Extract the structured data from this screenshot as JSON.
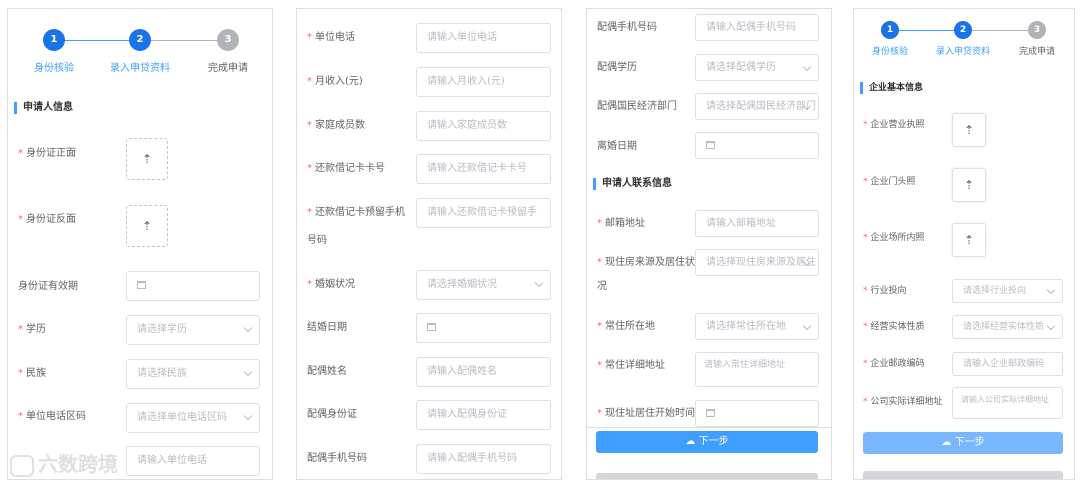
{
  "colors": {
    "primary": "#409eff",
    "step_active": "#1a73e8",
    "required": "#f56c6c"
  },
  "steps": [
    {
      "num": "1",
      "label": "身份核验"
    },
    {
      "num": "2",
      "label": "录入申贷资料"
    },
    {
      "num": "3",
      "label": "完成申请"
    }
  ],
  "panel1": {
    "section_title": "申请人信息",
    "id_front": "身份证正面",
    "id_back": "身份证反面",
    "id_validity": "身份证有效期",
    "education": "学历",
    "education_ph": "请选择学历",
    "ethnicity": "民族",
    "ethnicity_ph": "请选择民族",
    "area_code": "单位电话区码",
    "area_code_ph": "请选择单位电话区码",
    "unit_phone_ph": "请输入单位电话"
  },
  "panel2": {
    "unit_phone": "单位电话",
    "unit_phone_ph": "请输入单位电话",
    "income": "月收入(元)",
    "income_ph": "请输入月收入(元)",
    "family": "家庭成员数",
    "family_ph": "请输入家庭成员数",
    "card": "还款借记卡卡号",
    "card_ph": "请输入还款借记卡卡号",
    "card_phone_1": "还款借记卡预留手机",
    "card_phone_2": "号码",
    "card_phone_ph": "请输入还款借记卡预留手",
    "marital": "婚姻状况",
    "marital_ph": "请选择婚姻状况",
    "marriage_date": "结婚日期",
    "spouse_name": "配偶姓名",
    "spouse_name_ph": "请输入配偶姓名",
    "spouse_id": "配偶身份证",
    "spouse_id_ph": "请输入配偶身份证",
    "spouse_phone": "配偶手机号码",
    "spouse_phone_ph": "请输入配偶手机号码"
  },
  "panel3": {
    "spouse_phone": "配偶手机号码",
    "spouse_phone_ph": "请输入配偶手机号码",
    "spouse_edu": "配偶学历",
    "spouse_edu_ph": "请选择配偶学历",
    "spouse_dept": "配偶国民经济部门",
    "spouse_dept_ph": "请选择配偶国民经济部门",
    "divorce_date": "离婚日期",
    "section_title": "申请人联系信息",
    "email": "邮箱地址",
    "email_ph": "请输入邮箱地址",
    "housing_1": "现住房来源及居住状",
    "housing_2": "况",
    "housing_ph": "请选择现住房来源及居住",
    "residence": "常住所在地",
    "residence_ph": "请选择常住所在地",
    "address": "常住详细地址",
    "address_ph": "请输入常住详细地址",
    "since": "现住址居住开始时间",
    "next": "下一步"
  },
  "panel4": {
    "section_title": "企业基本信息",
    "license": "企业营业执照",
    "door": "企业门头照",
    "inside": "企业场所内照",
    "industry": "行业投向",
    "industry_ph": "请选择行业投向",
    "entity": "经营实体性质",
    "entity_ph": "请选择经营实体性质",
    "postcode": "企业邮政编码",
    "postcode_ph": "请输入企业邮政编码",
    "company_addr": "公司实际详细地址",
    "company_addr_ph": "请输入公司实际详细地址",
    "next": "下一步"
  },
  "watermark": "六数跨境"
}
